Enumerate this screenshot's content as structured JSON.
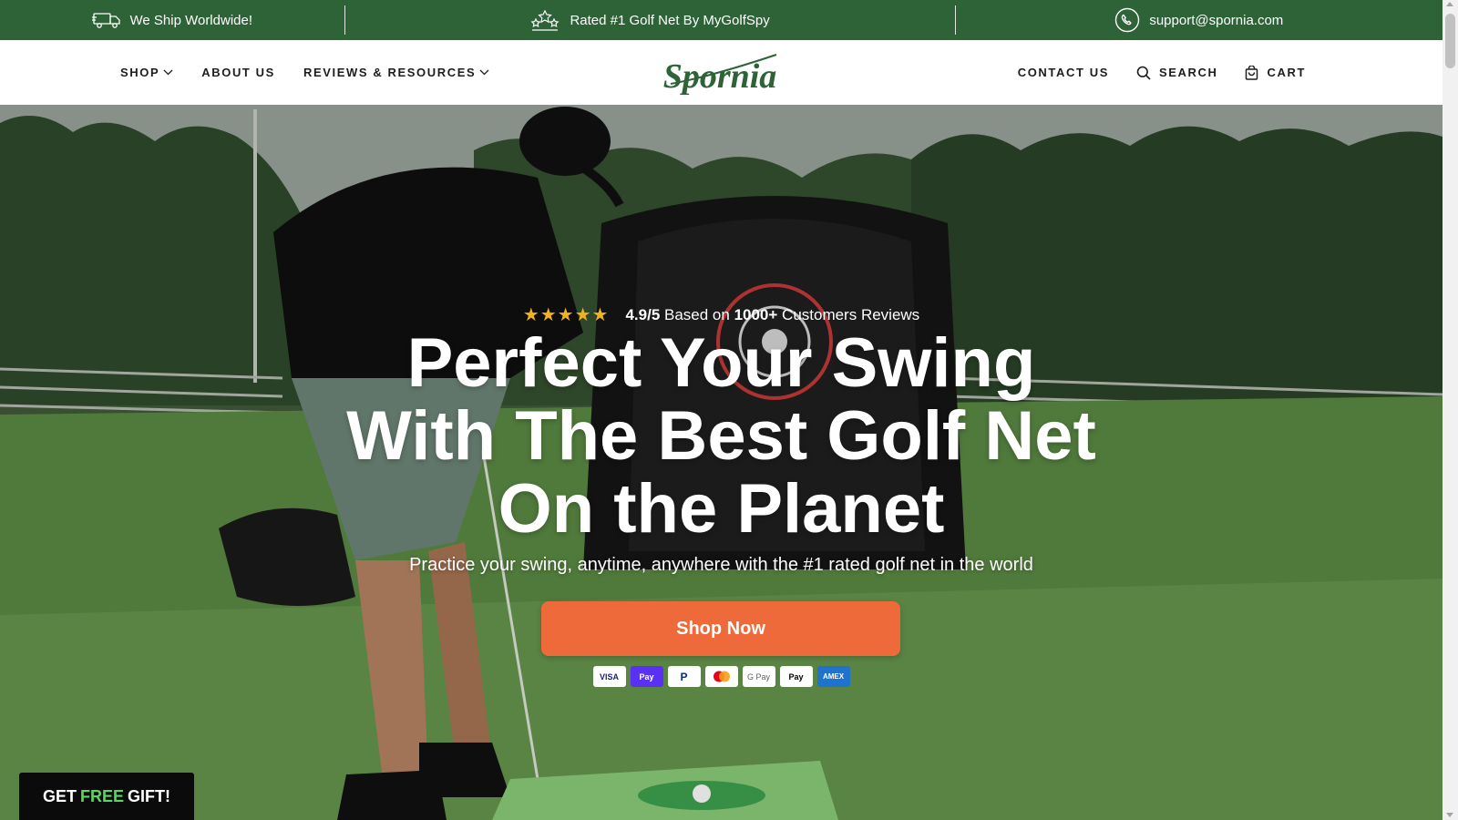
{
  "announcement": {
    "shipping": "We Ship Worldwide!",
    "rating": "Rated #1 Golf Net By MyGolfSpy",
    "email": "support@spornia.com"
  },
  "nav": {
    "shop": "SHOP",
    "about": "ABOUT US",
    "reviews": "REVIEWS & RESOURCES",
    "contact": "CONTACT US",
    "search": "SEARCH",
    "cart": "CART"
  },
  "logo": {
    "text": "Spornia",
    "color": "#2e6237"
  },
  "hero": {
    "stars": "★★★★★",
    "rating_score": "4.9/5",
    "rating_mid": " Based on ",
    "rating_count": "1000+",
    "rating_tail": " Customers Reviews",
    "headline_line1": "Perfect Your Swing",
    "headline_line2": "With The Best Golf Net",
    "headline_line3": "On the Planet",
    "subheadline": "Practice your swing, anytime, anywhere with the #1 rated golf net in the world",
    "cta": "Shop Now",
    "cta_color": "#ee6a3a"
  },
  "payments": [
    "VISA",
    "Pay",
    "P",
    "●●",
    "G Pay",
    "Pay",
    "AMEX"
  ],
  "gift": {
    "pre": "GET",
    "free": "FREE",
    "post": "GIFT!"
  },
  "colors": {
    "brand_green": "#2e6237",
    "star": "#f2b11d"
  }
}
